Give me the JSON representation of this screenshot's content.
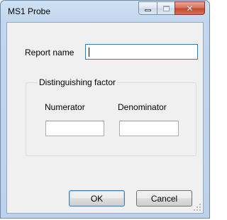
{
  "window": {
    "title": "MS1 Probe",
    "minimize_icon": "minimize-icon",
    "maximize_icon": "maximize-icon",
    "close_icon": "close-icon"
  },
  "form": {
    "report_name_label": "Report name",
    "report_name_value": "",
    "group_title": "Distinguishing factor",
    "numerator_label": "Numerator",
    "numerator_value": "",
    "denominator_label": "Denominator",
    "denominator_value": ""
  },
  "buttons": {
    "ok_label": "OK",
    "cancel_label": "Cancel"
  }
}
